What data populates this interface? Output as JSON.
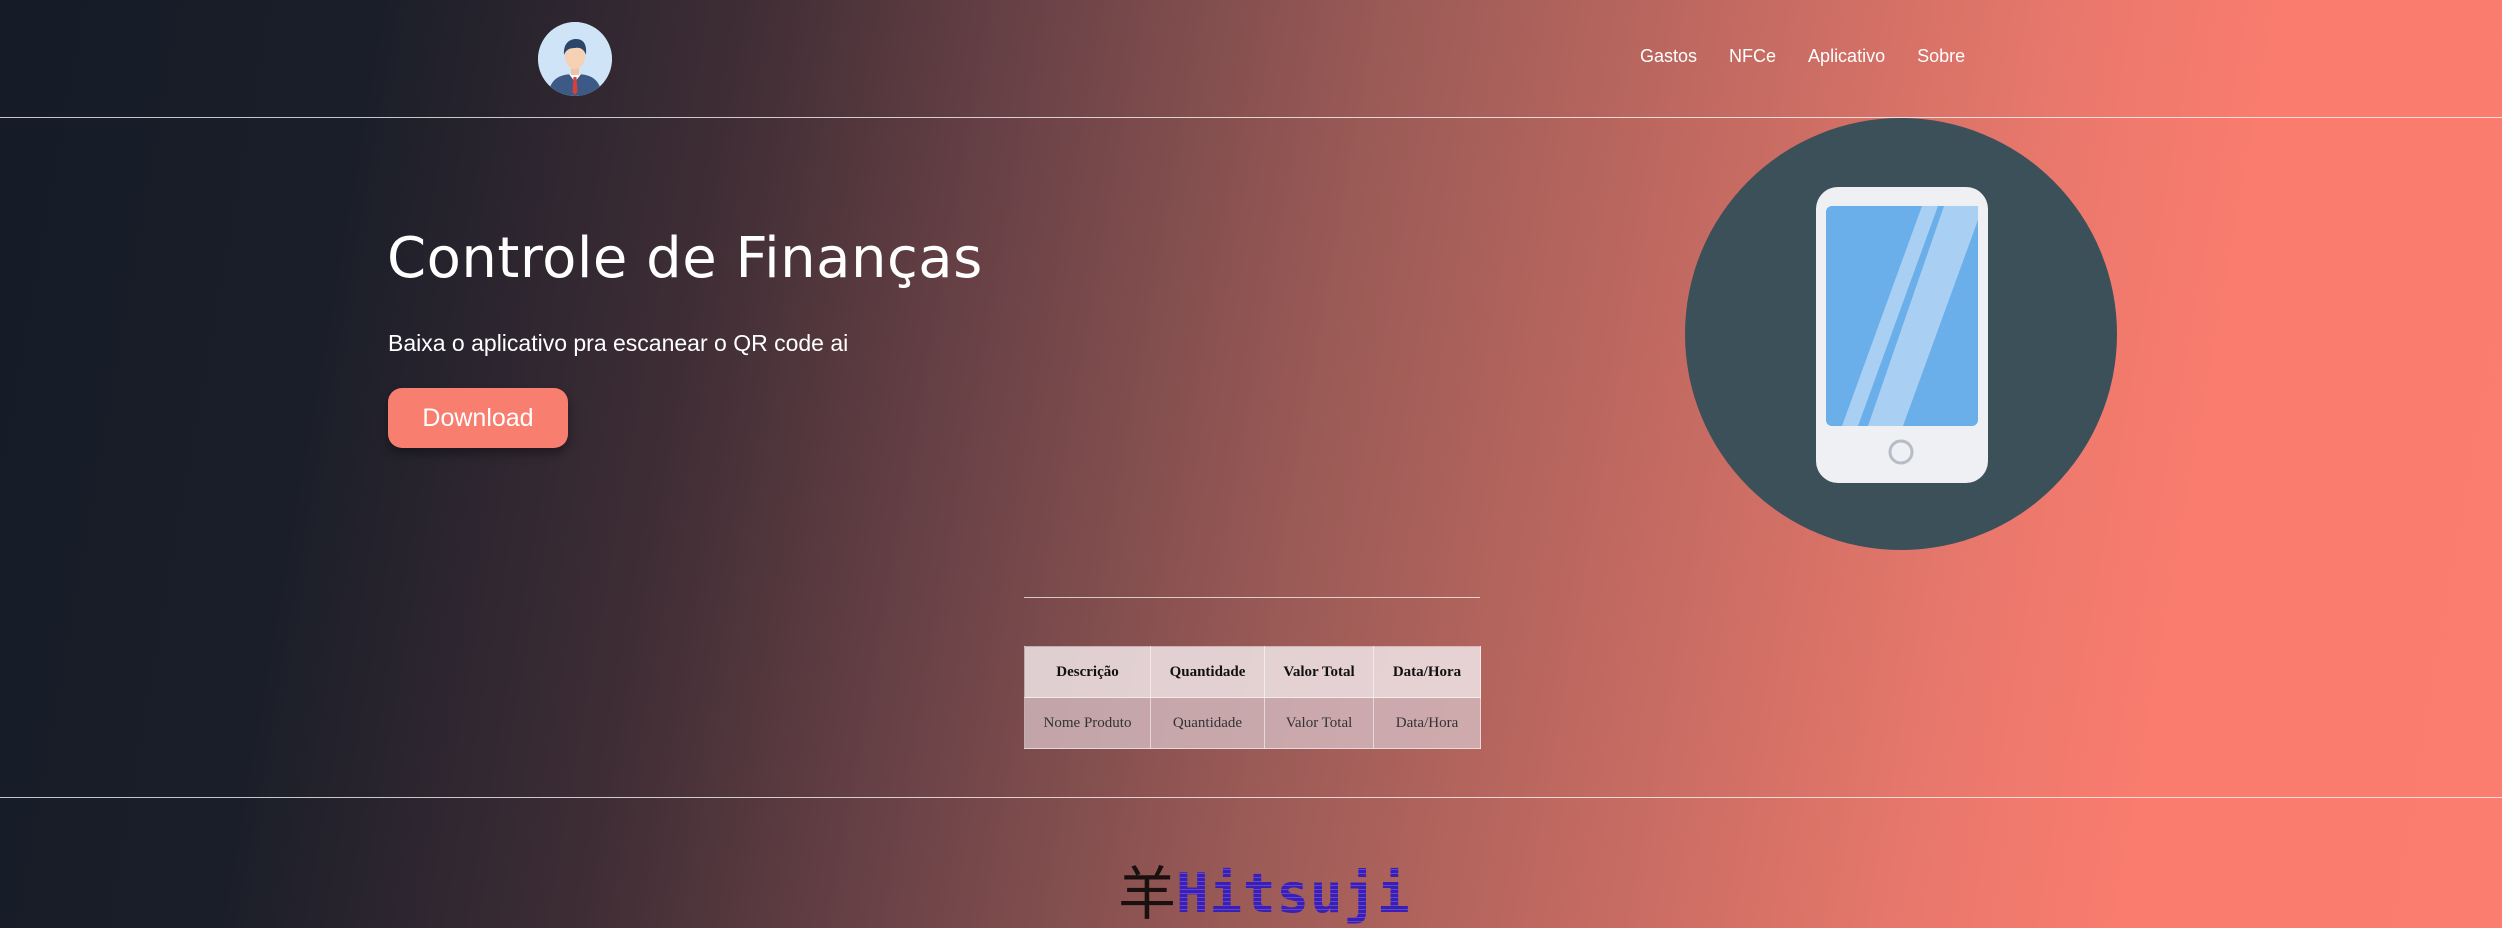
{
  "header": {
    "avatar_icon": "businessman-avatar-icon",
    "nav": [
      {
        "label": "Gastos"
      },
      {
        "label": "NFCe"
      },
      {
        "label": "Aplicativo"
      },
      {
        "label": "Sobre"
      }
    ]
  },
  "hero": {
    "title": "Controle de Finanças",
    "subtitle": "Baixa o aplicativo pra escanear o QR code ai",
    "download_label": "Download",
    "illustration_icon": "smartphone-icon",
    "accent_color": "#f87e70"
  },
  "table": {
    "headers": [
      "Descrição",
      "Quantidade",
      "Valor Total",
      "Data/Hora"
    ],
    "rows": [
      [
        "Nome Produto",
        "Quantidade",
        "Valor Total",
        "Data/Hora"
      ]
    ]
  },
  "footer": {
    "logo_kanji": "羊",
    "logo_text": "Hitsuji"
  }
}
